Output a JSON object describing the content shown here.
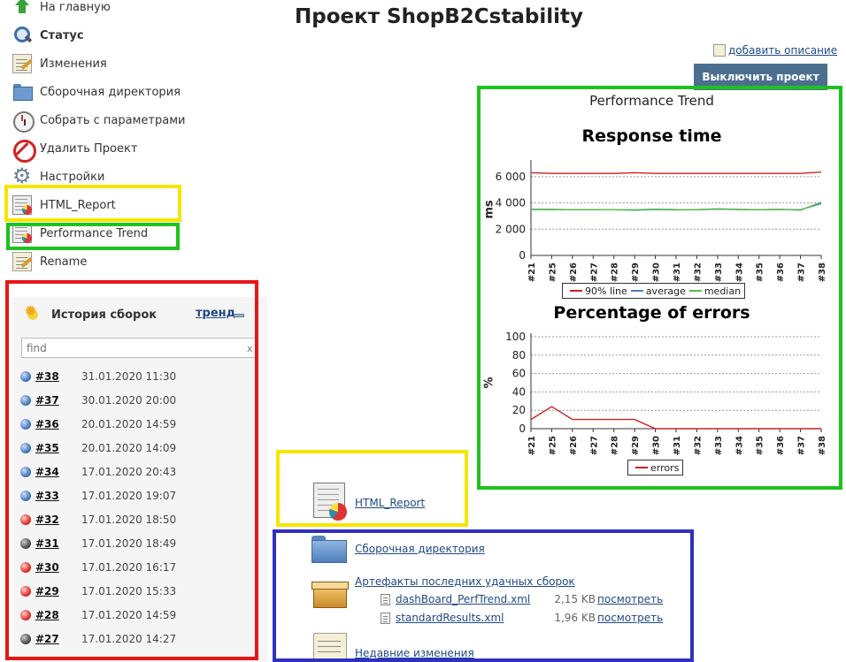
{
  "project_title": "Проект ShopB2Cstability",
  "menu": [
    {
      "label": "На главную",
      "icon": "home-icon"
    },
    {
      "label": "Статус",
      "icon": "search-icon"
    },
    {
      "label": "Изменения",
      "icon": "notepad-icon"
    },
    {
      "label": "Сборочная директория",
      "icon": "folder-icon"
    },
    {
      "label": "Собрать с параметрами",
      "icon": "clock-icon"
    },
    {
      "label": "Удалить Проект",
      "icon": "no-entry-icon"
    },
    {
      "label": "Настройки",
      "icon": "gear-icon"
    },
    {
      "label": "HTML_Report",
      "icon": "report-icon"
    },
    {
      "label": "Performance Trend",
      "icon": "report-icon"
    },
    {
      "label": "Rename",
      "icon": "notepad-icon"
    }
  ],
  "history": {
    "title": "История сборок",
    "trend_label": "тренд",
    "find_placeholder": "find",
    "clear_label": "x",
    "builds": [
      {
        "num": "#38",
        "date": "31.01.2020 11:30",
        "status": "blue"
      },
      {
        "num": "#37",
        "date": "30.01.2020 20:00",
        "status": "blue"
      },
      {
        "num": "#36",
        "date": "20.01.2020 14:59",
        "status": "blue"
      },
      {
        "num": "#35",
        "date": "20.01.2020 14:09",
        "status": "blue"
      },
      {
        "num": "#34",
        "date": "17.01.2020 20:43",
        "status": "blue"
      },
      {
        "num": "#33",
        "date": "17.01.2020 19:07",
        "status": "blue"
      },
      {
        "num": "#32",
        "date": "17.01.2020 18:50",
        "status": "red"
      },
      {
        "num": "#31",
        "date": "17.01.2020 18:49",
        "status": "gray"
      },
      {
        "num": "#30",
        "date": "17.01.2020 16:17",
        "status": "red"
      },
      {
        "num": "#29",
        "date": "17.01.2020 15:33",
        "status": "red"
      },
      {
        "num": "#28",
        "date": "17.01.2020 14:59",
        "status": "red"
      },
      {
        "num": "#27",
        "date": "17.01.2020 14:27",
        "status": "gray"
      }
    ]
  },
  "add_description": "добавить описание",
  "disable_button": "Выключить проект",
  "perf_trend_title": "Performance Trend",
  "links": {
    "html_report": "HTML_Report",
    "workspace": "Сборочная директория",
    "artifacts": "Артефакты последних удачных сборок",
    "recent_changes": "Недавние изменения"
  },
  "artifacts": [
    {
      "name": "dashBoard_PerfTrend.xml",
      "size": "2,15 KB",
      "view": "посмотреть"
    },
    {
      "name": "standardResults.xml",
      "size": "1,96 KB",
      "view": "посмотреть"
    }
  ],
  "colors": {
    "yellow_highlight": "#f5e600",
    "green_highlight": "#1ec21e",
    "red_highlight": "#e81616",
    "blue_highlight": "#3030c0",
    "line_90": "#cc2222",
    "line_avg": "#4a7fc0",
    "line_median": "#55bb44"
  },
  "chart_data": [
    {
      "type": "line",
      "title": "Response time",
      "ylabel": "ms",
      "xlabel": "",
      "ylim": [
        0,
        7000
      ],
      "yticks": [
        0,
        2000,
        4000,
        6000
      ],
      "ytick_labels": [
        "0",
        "2 000",
        "4 000",
        "6 000"
      ],
      "grid": true,
      "legend": "bottom",
      "categories": [
        "#21",
        "#25",
        "#26",
        "#27",
        "#28",
        "#29",
        "#30",
        "#31",
        "#32",
        "#33",
        "#34",
        "#35",
        "#36",
        "#37",
        "#38"
      ],
      "series": [
        {
          "name": "90% line",
          "color": "#cc2222",
          "values": [
            6300,
            6250,
            6250,
            6250,
            6250,
            6300,
            6250,
            6250,
            6250,
            6250,
            6250,
            6250,
            6250,
            6250,
            6350
          ]
        },
        {
          "name": "average",
          "color": "#4a7fc0",
          "values": [
            3500,
            3500,
            3480,
            3480,
            3480,
            3450,
            3500,
            3470,
            3480,
            3520,
            3500,
            3480,
            3500,
            3480,
            3950
          ]
        },
        {
          "name": "median",
          "color": "#55bb44",
          "values": [
            3520,
            3500,
            3490,
            3490,
            3480,
            3480,
            3520,
            3490,
            3490,
            3550,
            3500,
            3490,
            3510,
            3450,
            4050
          ]
        }
      ]
    },
    {
      "type": "line",
      "title": "Percentage of errors",
      "ylabel": "%",
      "xlabel": "",
      "ylim": [
        0,
        100
      ],
      "yticks": [
        0,
        20,
        40,
        60,
        80,
        100
      ],
      "ytick_labels": [
        "0",
        "20",
        "40",
        "60",
        "80",
        "100"
      ],
      "grid": true,
      "legend": "bottom",
      "categories": [
        "#21",
        "#25",
        "#26",
        "#27",
        "#28",
        "#29",
        "#30",
        "#31",
        "#32",
        "#33",
        "#34",
        "#35",
        "#36",
        "#37",
        "#38"
      ],
      "series": [
        {
          "name": "errors",
          "color": "#cc2222",
          "values": [
            10,
            24,
            10,
            10,
            10,
            10,
            0,
            0,
            0,
            0,
            0,
            0,
            0,
            0,
            0
          ]
        }
      ]
    }
  ]
}
